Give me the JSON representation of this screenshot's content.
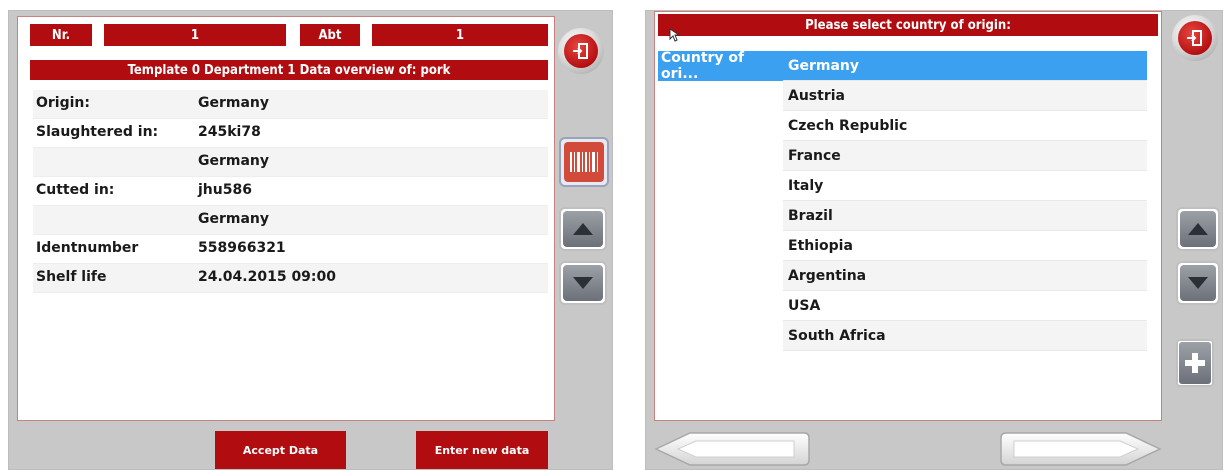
{
  "left": {
    "header": {
      "nr_label": "Nr.",
      "nr_value": "1",
      "abt_label": "Abt",
      "abt_value": "1"
    },
    "title": "Template 0 Department 1 Data overview of: pork",
    "rows": [
      {
        "label": "Origin:",
        "value": "Germany"
      },
      {
        "label": "Slaughtered in:",
        "value": "245ki78"
      },
      {
        "label": "",
        "value": "Germany"
      },
      {
        "label": "Cutted in:",
        "value": "jhu586"
      },
      {
        "label": "",
        "value": "Germany"
      },
      {
        "label": "Identnumber",
        "value": "558966321"
      },
      {
        "label": "Shelf life",
        "value": "24.04.2015 09:00"
      }
    ],
    "buttons": {
      "accept": "Accept Data",
      "new_data": "Enter new data"
    }
  },
  "right": {
    "title": "Please select country of origin:",
    "column_header": "Country of ori...",
    "countries": [
      "Germany",
      "Austria",
      "Czech Republic",
      "France",
      "Italy",
      "Brazil",
      "Ethiopia",
      "Argentina",
      "USA",
      "South Africa"
    ],
    "selected_index": 0
  },
  "icons": {
    "exit": "exit-door-icon",
    "barcode": "barcode-icon",
    "up": "arrow-up-icon",
    "down": "arrow-down-icon",
    "plus": "plus-icon",
    "back": "arrow-left-icon",
    "forward": "arrow-right-icon"
  },
  "colors": {
    "accent_red": "#b10d10",
    "selection_blue": "#3ca0f0",
    "frame_gray": "#c8c8c8"
  }
}
